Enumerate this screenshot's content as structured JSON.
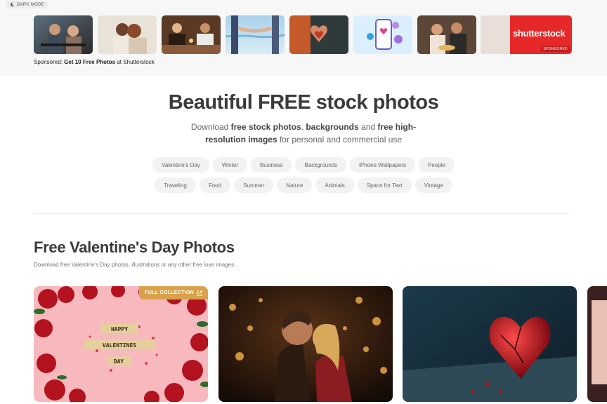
{
  "header": {
    "dark_mode_label": "DARK MODE",
    "sponsored": {
      "prefix": "Sponsored:",
      "link": "Get 10 Free Photos",
      "suffix": "at Shutterstock"
    },
    "thumbnails": [
      "couple-cafe",
      "couple-embrace",
      "couple-dinner",
      "hands-beach",
      "heart-hands",
      "phone-love",
      "couple-dinner-2"
    ],
    "shutterstock": {
      "logo": "shutterstock",
      "badge": "SPONSORED"
    }
  },
  "hero": {
    "title": "Beautiful FREE stock photos",
    "sub_1": "Download ",
    "sub_b1": "free stock photos",
    "sub_2": ", ",
    "sub_b2": "backgrounds",
    "sub_3": " and ",
    "sub_b3": "free high-resolution images",
    "sub_4": " for personal and commercial use"
  },
  "tags_row1": [
    "Valentine's Day",
    "Winter",
    "Business",
    "Backgrounds",
    "iPhone Wallpapers",
    "People"
  ],
  "tags_row2": [
    "Traveling",
    "Food",
    "Summer",
    "Nature",
    "Animals",
    "Space for Text",
    "Vintage"
  ],
  "section": {
    "title": "Free Valentine's Day Photos",
    "subtitle": "Download free Valentine's Day photos, illustrations or any other free love images.",
    "full_collection": "FULL COLLECTION",
    "cards": [
      "happy-valentines-day-tiles",
      "couple-bokeh-kiss",
      "red-glass-heart"
    ],
    "tile_words": [
      "HAPPY",
      "VALENTINES",
      "DAY"
    ]
  },
  "colors": {
    "accent": "#d9a24a",
    "shutterstock_red": "#e62828",
    "tag_bg": "#f2f2f2"
  }
}
